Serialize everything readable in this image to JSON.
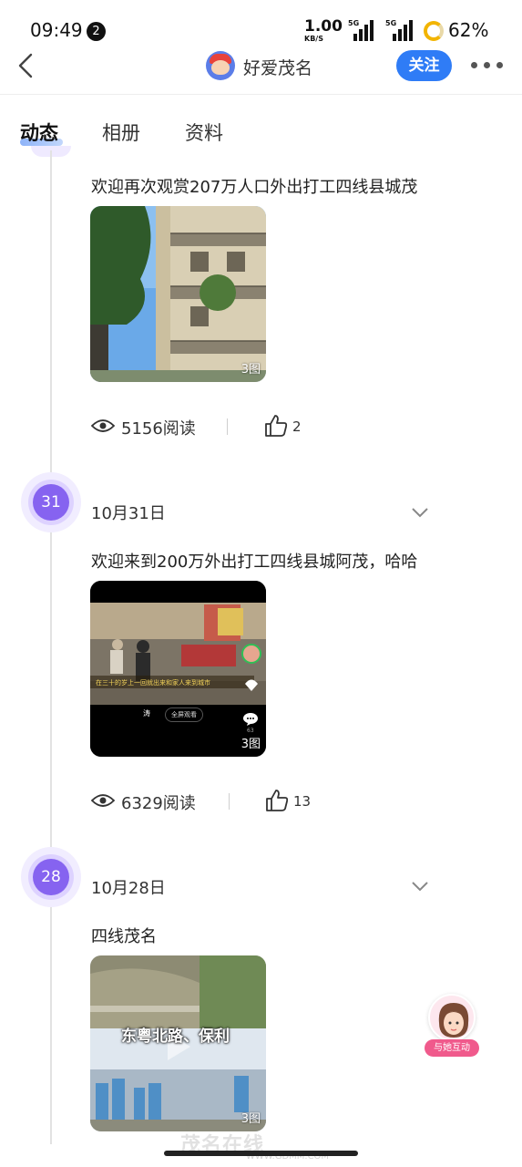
{
  "status_bar": {
    "time": "09:49",
    "notification_count": "2",
    "net_speed": "1.00",
    "net_unit": "KB/S",
    "sim1": "5G",
    "sim2": "5G",
    "battery": "62%"
  },
  "header": {
    "title": "好爱茂名",
    "follow_label": "关注"
  },
  "tabs": [
    {
      "label": "动态",
      "active": true
    },
    {
      "label": "相册",
      "active": false
    },
    {
      "label": "资料",
      "active": false
    }
  ],
  "posts": [
    {
      "text": "欢迎再次观赏207万人口外出打工四线县城茂",
      "image_count": "3图",
      "reads": "5156阅读",
      "likes": "2"
    },
    {
      "day": "31",
      "date": "10月31日",
      "text": "欢迎来到200万外出打工四线县城阿茂，哈哈",
      "video_caption": "在三十的岁上一回就出来和家人来到城市",
      "video_btn1": "涛",
      "video_btn2": "全屏观看",
      "video_comments": "63",
      "image_count": "3图",
      "reads": "6329阅读",
      "likes": "13"
    },
    {
      "day": "28",
      "date": "10月28日",
      "text": "四线茂名",
      "image_caption": "东粤北路、保利",
      "image_count": "3图"
    }
  ],
  "floating": {
    "label": "与她互动"
  },
  "watermark": {
    "text": "茂名在线",
    "url": "WWW.GDMM.COM"
  },
  "colors": {
    "accent_blue": "#2f7cf6",
    "timeline_purple": "#8663f0",
    "float_pink": "#f05a8c"
  }
}
